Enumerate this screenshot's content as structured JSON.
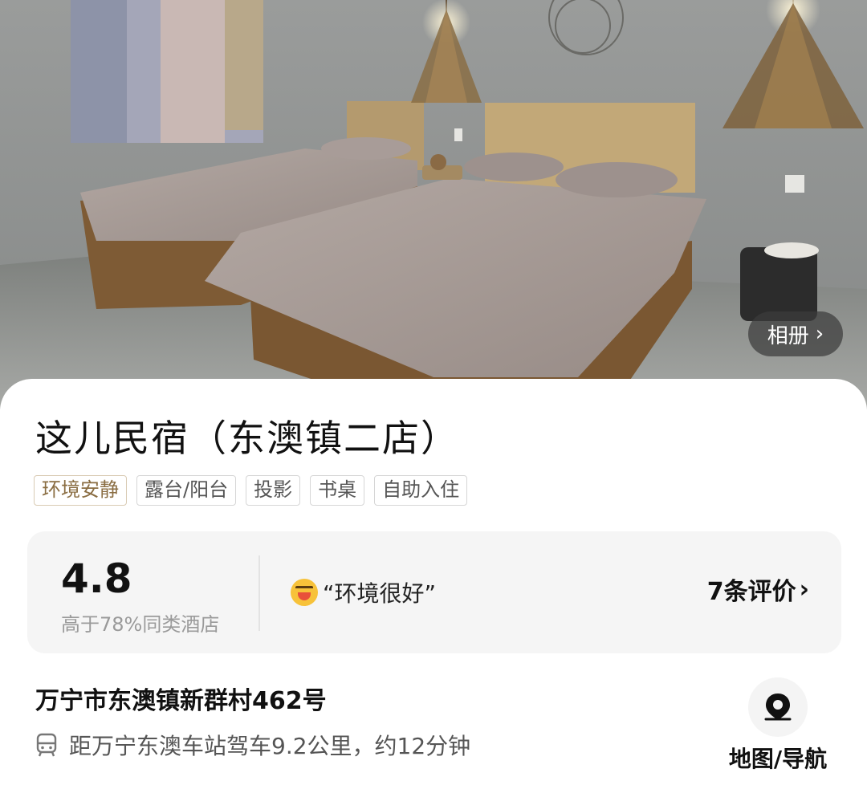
{
  "hero": {
    "album_label": "相册",
    "album_chevron": "›",
    "colors": {
      "wall": "#8c8f8e",
      "floor": "#7d807d",
      "bedding": "#a59a96",
      "wood": "#7a5a36"
    }
  },
  "hotel": {
    "name": "这儿民宿（东澳镇二店）",
    "tags": [
      "环境安静",
      "露台/阳台",
      "投影",
      "书桌",
      "自助入住"
    ]
  },
  "review": {
    "score": "4.8",
    "score_sub": "高于78%同类酒店",
    "emoji": "laughing-emoji",
    "quote": "“环境很好”",
    "count_label": "7条评价",
    "chevron": "›"
  },
  "location": {
    "address": "万宁市东澳镇新群村462号",
    "distance": "距万宁东澳车站驾车9.2公里，约12分钟",
    "transit_icon": "bus-icon",
    "map_icon": "location-pin-icon",
    "map_label": "地图/导航"
  },
  "colors": {
    "accent_tag": "#8a6d42",
    "card_bg": "#f5f5f5",
    "muted_text": "#9a9a9a"
  }
}
